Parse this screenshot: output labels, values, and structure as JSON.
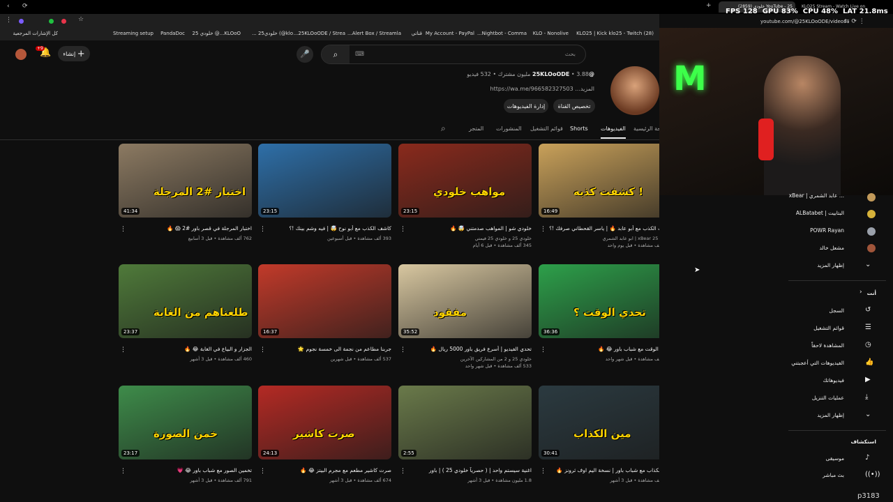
{
  "browser": {
    "tabs": [
      {
        "label": "YouTube - 25 خلودي (2859)"
      },
      {
        "label": "KLO25 Stream - Watch Live on"
      }
    ],
    "url": "youtube.com/@25KLOoODE/videos",
    "bookmarks": [
      "كل الإشارات المرجعية",
      "Streaming setup",
      "PandaDoc",
      "KLOoO...@ خلودي 25",
      "klo@) خلودي25 ...",
      "25KLOoODE / Strea...",
      "Alert Box / Streamla...",
      "قناتي",
      "My Account - PayPal",
      "Nightbot - Comma...",
      "KLO - Nonolive",
      "KLO25 | Kick",
      "(28) klo25 - Twitch"
    ]
  },
  "stats": {
    "fps_label": "FPS",
    "fps": "128",
    "gpu_label": "GPU",
    "gpu": "83",
    "cpu_label": "CPU",
    "cpu": "48",
    "lat_label": "LAT",
    "lat": "21.8",
    "gpu_unit": "%",
    "cpu_unit": "%",
    "lat_unit": "ms"
  },
  "header": {
    "search_placeholder": "بحث",
    "create_label": "إنشاء",
    "notif_count": "+9"
  },
  "channel": {
    "handle": "@25KLOoODE",
    "subs": "3.88 مليون مشترك",
    "videos": "532 فيديو",
    "link": "https://wa.me/966582327503 ...المزيد",
    "customize": "تخصيص القناة",
    "manage": "إدارة الفيديوهات"
  },
  "tabs": [
    "الصفحة الرئيسية",
    "الفيديوهات",
    "Shorts",
    "قوائم التشغيل",
    "المنشورات",
    "المتجر"
  ],
  "videos": [
    {
      "title": "كاشف الكذب مع أبو عابد 🔥 | ياسر القحطاني صرفك !؟",
      "meta1": "خلودي 25 xBear | ابو عابد الشمري",
      "meta2": "184 ألف مشاهدة • قبل يوم واحد",
      "dur": "16:49",
      "ttext": "كشفت كذبه !",
      "bg": "#c9a15a"
    },
    {
      "title": "خلودي شو | المواهب صدمتني 🤯 🔥",
      "meta1": "خلودي 25 و خلودي 25 فيمتي",
      "meta2": "345 ألف مشاهدة • قبل 6 أيام",
      "dur": "23:15",
      "ttext": "مواهب خلودي",
      "bg": "#8a2a1c"
    },
    {
      "title": "كاشف الكذب مع أبو نوح 🤯 | فيه وشم بينك !؟",
      "meta1": "",
      "meta2": "393 ألف مشاهدة • قبل أسبوعين",
      "dur": "23:15",
      "ttext": "",
      "bg": "#2e6fa8"
    },
    {
      "title": "اختبار المرجلة في قصر باور #2 😱 🔥",
      "meta1": "",
      "meta2": "762 ألف مشاهدة • قبل 3 أسابيع",
      "dur": "41:34",
      "ttext": "اختبار #2 المرجلة",
      "bg": "#8c7a62"
    },
    {
      "title": "تحدي الوقت مع شباب باور 😂 🔥",
      "meta1": "",
      "meta2": "820 ألف مشاهدة • قبل شهر واحد",
      "dur": "36:36",
      "ttext": "تحدي الوقت ؟",
      "bg": "#2da04a"
    },
    {
      "title": "تحدي الفيديو | أسرع فريق باور 5000 ريال 🔥",
      "meta1": "خلودي 25 و 2 من المشاركين الآخرين",
      "meta2": "533 ألف مشاهدة • قبل شهر واحد",
      "dur": "35:52",
      "ttext": "مفقود",
      "bg": "#d8c7a0"
    },
    {
      "title": "جربنا مطاعم من نجمة الى خمسة نجوم 🌟",
      "meta1": "",
      "meta2": "537 ألف مشاهدة • قبل شهرين",
      "dur": "16:37",
      "ttext": "",
      "bg": "#c23a2a"
    },
    {
      "title": "الجزار و البياع في الغابة 😂 🔥",
      "meta1": "",
      "meta2": "460 ألف مشاهدة • قبل 3 أشهر",
      "dur": "23:37",
      "ttext": "طلعناهم من الغابة !",
      "bg": "#4f7a3a"
    },
    {
      "title": "مين الكذاب مع شباب باور | نسخة اليم اوف ثرونز 🔥",
      "meta1": "",
      "meta2": "596 ألف مشاهدة • قبل 3 أشهر",
      "dur": "30:41",
      "ttext": "مين الكذاب",
      "bg": "#2b3a40"
    },
    {
      "title": "اغنية سيستم واحد | ( حصرياً خلودي 25 ) | باور",
      "meta1": "",
      "meta2": "1.8 مليون مشاهدة • قبل 3 أشهر",
      "dur": "2:55",
      "ttext": "",
      "bg": "#6a7a4a"
    },
    {
      "title": "صرت كاشير مطعم مع مجرم البيتز 😂 🔥",
      "meta1": "",
      "meta2": "674 ألف مشاهدة • قبل 3 أشهر",
      "dur": "24:13",
      "ttext": "صرت كاشير",
      "bg": "#b42a24"
    },
    {
      "title": "تخمين الصور مع شباب باور 😂 💗",
      "meta1": "",
      "meta2": "791 ألف مشاهدة • قبل 3 أشهر",
      "dur": "23:17",
      "ttext": "خمن الصورة",
      "bg": "#3e8c4a"
    }
  ],
  "sidebar": {
    "subs": [
      "xBear | عابد الشمري ...",
      "ALBatabet | البتابيت",
      "POWR Rayan",
      "مشعل خالد",
      "إظهار المزيد"
    ],
    "you_title": "أنت",
    "you": [
      "السجل",
      "قوائم التشغيل",
      "المشاهدة لاحقاً",
      "الفيديوهات التي أعجبتني",
      "فيديوهاتك",
      "عمليات التنزيل",
      "إظهار المزيد"
    ],
    "explore_title": "استكشاف",
    "explore": [
      "موسيقى",
      "بث مباشر"
    ]
  },
  "footer_tag": "p3183"
}
